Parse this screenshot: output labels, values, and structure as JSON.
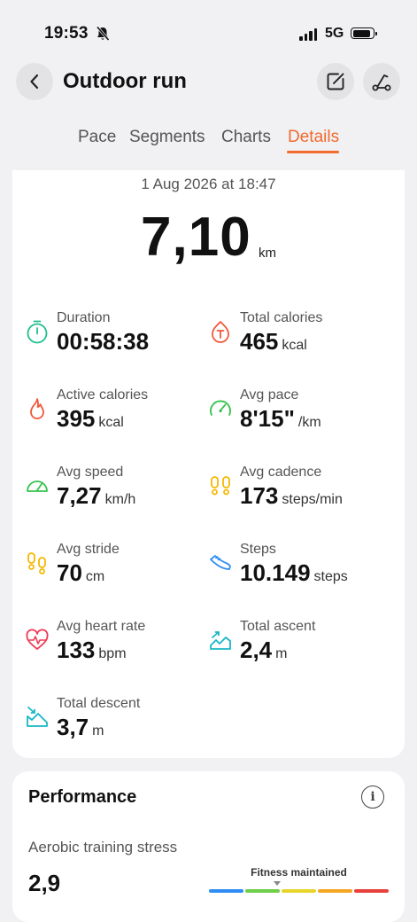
{
  "status_bar": {
    "time": "19:53",
    "network": "5G"
  },
  "header": {
    "title": "Outdoor run"
  },
  "tabs": [
    {
      "label": "Pace"
    },
    {
      "label": "Segments"
    },
    {
      "label": "Charts"
    },
    {
      "label": "Details",
      "active": true
    }
  ],
  "summary": {
    "date": "1 Aug 2026 at 18:47",
    "distance": "7,10",
    "distance_unit": "km"
  },
  "metrics": [
    {
      "label": "Duration",
      "value": "00:58:38",
      "unit": "",
      "icon": "stopwatch-icon",
      "color": "#1fbf8f"
    },
    {
      "label": "Total calories",
      "value": "465",
      "unit": "kcal",
      "icon": "calories-icon",
      "color": "#f2573a"
    },
    {
      "label": "Active calories",
      "value": "395",
      "unit": "kcal",
      "icon": "flame-icon",
      "color": "#f2573a"
    },
    {
      "label": "Avg pace",
      "value": "8'15\"",
      "unit": "/km",
      "icon": "pace-gauge-icon",
      "color": "#35c24a"
    },
    {
      "label": "Avg speed",
      "value": "7,27",
      "unit": "km/h",
      "icon": "speedometer-icon",
      "color": "#35c24a"
    },
    {
      "label": "Avg cadence",
      "value": "173",
      "unit": "steps/min",
      "icon": "footprints-icon",
      "color": "#f5b800"
    },
    {
      "label": "Avg stride",
      "value": "70",
      "unit": "cm",
      "icon": "footprints-icon",
      "color": "#f5b800"
    },
    {
      "label": "Steps",
      "value": "10.149",
      "unit": "steps",
      "icon": "shoe-icon",
      "color": "#2f8df5"
    },
    {
      "label": "Avg heart rate",
      "value": "133",
      "unit": "bpm",
      "icon": "heart-rate-icon",
      "color": "#ef3b55"
    },
    {
      "label": "Total ascent",
      "value": "2,4",
      "unit": "m",
      "icon": "ascent-icon",
      "color": "#18b7c7"
    },
    {
      "label": "Total descent",
      "value": "3,7",
      "unit": "m",
      "icon": "descent-icon",
      "color": "#18b7c7"
    }
  ],
  "performance": {
    "title": "Performance",
    "stress_label": "Aerobic training stress",
    "stress_value": "2,9",
    "fitness_label": "Fitness maintained",
    "fitness_colors": [
      "#2f8df5",
      "#6fce4a",
      "#e7d52c",
      "#f5a623",
      "#e8403a"
    ]
  },
  "colors": {
    "accent": "#f26a2e"
  }
}
